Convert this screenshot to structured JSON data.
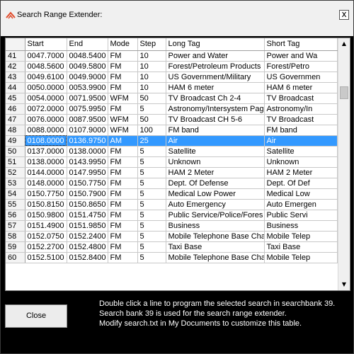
{
  "window": {
    "title": "Search Range Extender:",
    "close_glyph": "x"
  },
  "columns": [
    "",
    "Start",
    "End",
    "Mode",
    "Step",
    "Long Tag",
    "Short Tag"
  ],
  "rows": [
    {
      "num": "41",
      "start": "0047.7000",
      "end": "0048.5400",
      "mode": "FM",
      "step": "10",
      "long": "Power and Water",
      "short": "Power and Wa"
    },
    {
      "num": "42",
      "start": "0048.5600",
      "end": "0049.5800",
      "mode": "FM",
      "step": "10",
      "long": "Forest/Petroleum Products",
      "short": "Forest/Petro"
    },
    {
      "num": "43",
      "start": "0049.6100",
      "end": "0049.9000",
      "mode": "FM",
      "step": "10",
      "long": "US Government/Military",
      "short": "US Governmen"
    },
    {
      "num": "44",
      "start": "0050.0000",
      "end": "0053.9900",
      "mode": "FM",
      "step": "10",
      "long": "HAM 6 meter",
      "short": "HAM 6 meter"
    },
    {
      "num": "45",
      "start": "0054.0000",
      "end": "0071.9500",
      "mode": "WFM",
      "step": "50",
      "long": "TV Broadcast Ch 2-4",
      "short": "TV Broadcast"
    },
    {
      "num": "46",
      "start": "0072.0000",
      "end": "0075.9950",
      "mode": "FM",
      "step": "5",
      "long": "Astronomy/Intersystem Pag",
      "short": "Astronomy/In"
    },
    {
      "num": "47",
      "start": "0076.0000",
      "end": "0087.9500",
      "mode": "WFM",
      "step": "50",
      "long": "TV Broadcast CH 5-6",
      "short": "TV Broadcast"
    },
    {
      "num": "48",
      "start": "0088.0000",
      "end": "0107.9000",
      "mode": "WFM",
      "step": "100",
      "long": "FM band",
      "short": "FM band"
    },
    {
      "num": "49",
      "start": "0108.0000",
      "end": "0136.9750",
      "mode": "AM",
      "step": "25",
      "long": "Air",
      "short": "Air",
      "selected": true
    },
    {
      "num": "50",
      "start": "0137.0000",
      "end": "0138.0000",
      "mode": "FM",
      "step": "5",
      "long": "Satellite",
      "short": "Satellite"
    },
    {
      "num": "51",
      "start": "0138.0000",
      "end": "0143.9950",
      "mode": "FM",
      "step": "5",
      "long": "Unknown",
      "short": "Unknown"
    },
    {
      "num": "52",
      "start": "0144.0000",
      "end": "0147.9950",
      "mode": "FM",
      "step": "5",
      "long": "HAM 2 Meter",
      "short": "HAM 2 Meter"
    },
    {
      "num": "53",
      "start": "0148.0000",
      "end": "0150.7750",
      "mode": "FM",
      "step": "5",
      "long": "Dept. Of Defense",
      "short": "Dept. Of Def"
    },
    {
      "num": "54",
      "start": "0150.7750",
      "end": "0150.7900",
      "mode": "FM",
      "step": "5",
      "long": "Medical Low Power",
      "short": "Medical Low"
    },
    {
      "num": "55",
      "start": "0150.8150",
      "end": "0150.8650",
      "mode": "FM",
      "step": "5",
      "long": "Auto Emergency",
      "short": "Auto Emergen"
    },
    {
      "num": "56",
      "start": "0150.9800",
      "end": "0151.4750",
      "mode": "FM",
      "step": "5",
      "long": "Public Service/Police/Fores",
      "short": "Public Servi"
    },
    {
      "num": "57",
      "start": "0151.4900",
      "end": "0151.9850",
      "mode": "FM",
      "step": "5",
      "long": "Business",
      "short": "Business"
    },
    {
      "num": "58",
      "start": "0152.0750",
      "end": "0152.2400",
      "mode": "FM",
      "step": "5",
      "long": "Mobile Telephone Base Cha",
      "short": "Mobile Telep"
    },
    {
      "num": "59",
      "start": "0152.2700",
      "end": "0152.4800",
      "mode": "FM",
      "step": "5",
      "long": "Taxi Base",
      "short": "Taxi Base"
    },
    {
      "num": "60",
      "start": "0152.5100",
      "end": "0152.8400",
      "mode": "FM",
      "step": "5",
      "long": "Mobile Telephone Base Cha",
      "short": "Mobile Telep"
    }
  ],
  "scrollbar": {
    "up_glyph": "▲",
    "down_glyph": "▼",
    "position_fraction": 0.17
  },
  "footer": {
    "close_label": "Close",
    "info_lines": [
      "Double click a line to program the selected search in searchbank 39.",
      "Search bank 39 is used for the search range extender.",
      "Modify search.txt in My Documents to customize this table."
    ]
  },
  "colors": {
    "selection": "#3399ff",
    "background": "#000000",
    "title_icon": "#e04a2a"
  }
}
